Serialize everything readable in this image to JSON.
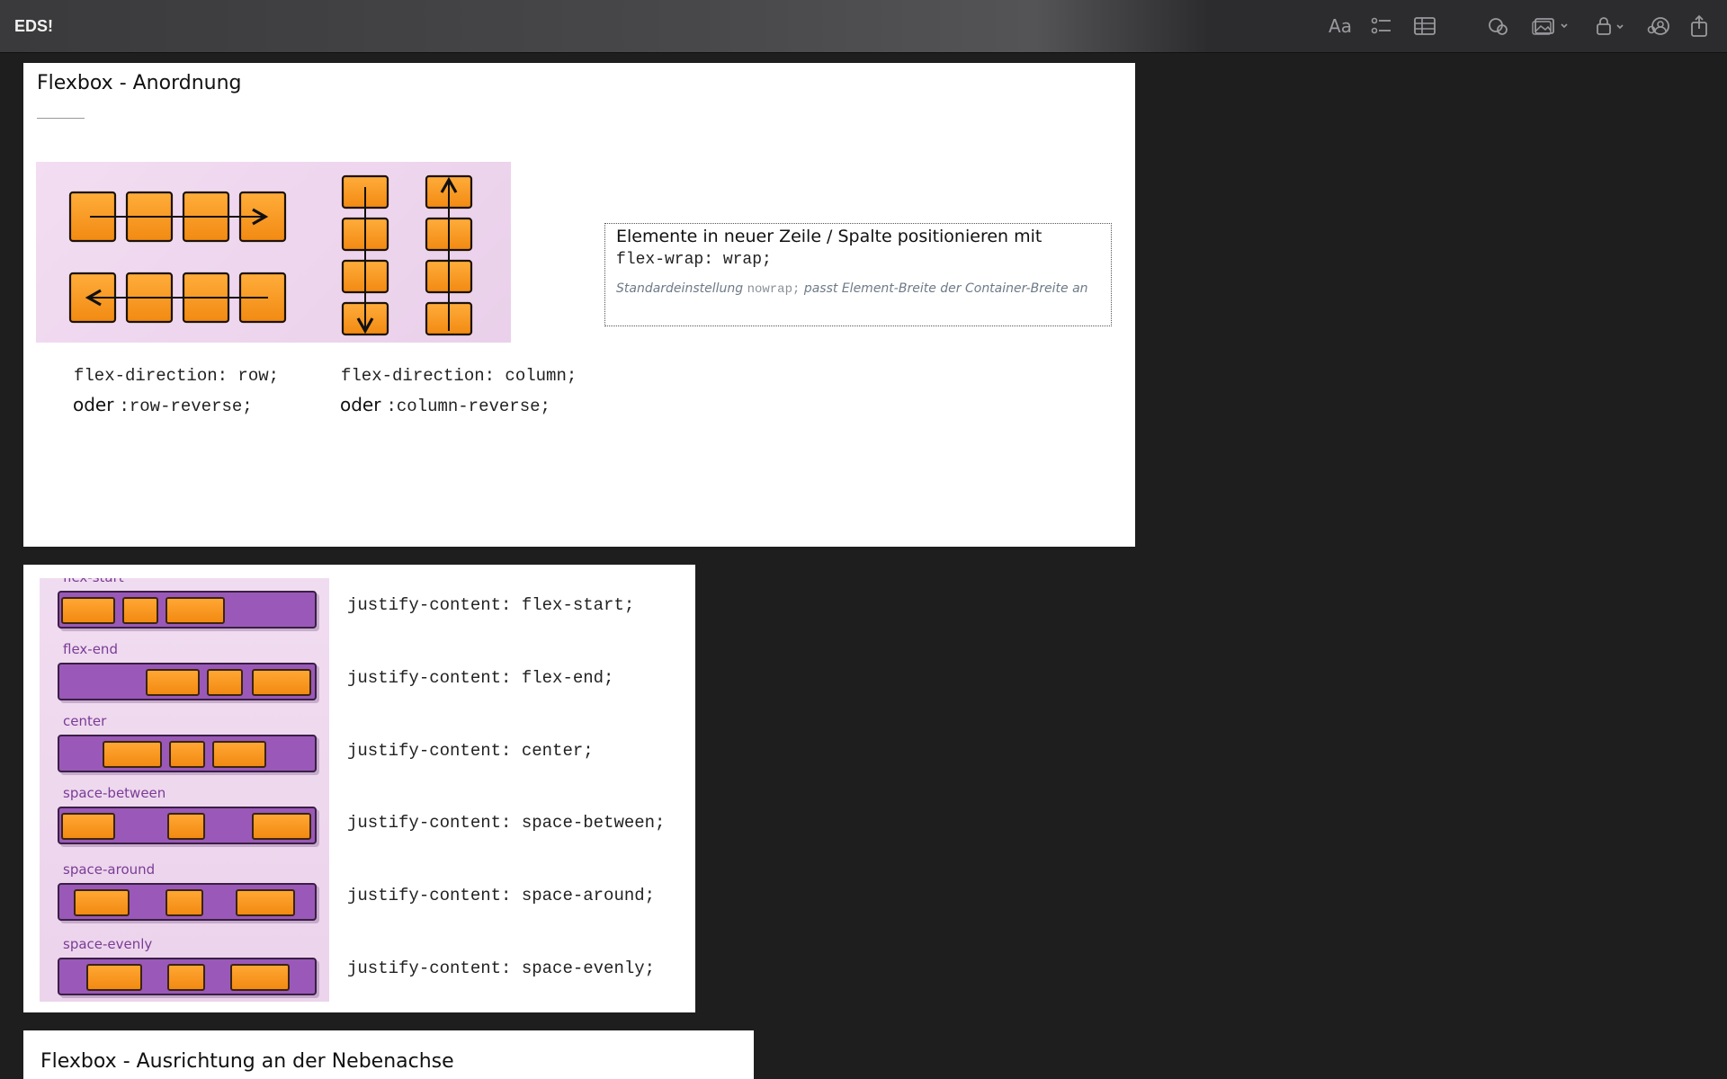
{
  "app": {
    "title": "EDS!"
  },
  "toolbar": {
    "icons": [
      "text-format-icon",
      "checklist-icon",
      "table-icon",
      "collaborate-icon",
      "media-icon",
      "lock-icon",
      "share-person-icon",
      "share-icon"
    ],
    "format_label": "Aa"
  },
  "section1": {
    "title": "Flexbox - Anordnung",
    "row_code": "flex-direction: row;",
    "row_alt_word": "oder",
    "row_alt_code": ":row-reverse;",
    "col_code": "flex-direction: column;",
    "col_alt_word": "oder",
    "col_alt_code": ":column-reverse;",
    "wrap_heading": "Elemente in neuer Zeile / Spalte positionieren mit",
    "wrap_code": "flex-wrap: wrap;",
    "wrap_note_pre": "Standardeinstellung",
    "wrap_note_code": "nowrap;",
    "wrap_note_post": "passt Element-Breite der Container-Breite an"
  },
  "section2": {
    "items": [
      {
        "label": "flex-start",
        "code": "justify-content: flex-start;"
      },
      {
        "label": "flex-end",
        "code": "justify-content: flex-end;"
      },
      {
        "label": "center",
        "code": "justify-content: center;"
      },
      {
        "label": "space-between",
        "code": "justify-content: space-between;"
      },
      {
        "label": "space-around",
        "code": "justify-content: space-around;"
      },
      {
        "label": "space-evenly",
        "code": "justify-content: space-evenly;"
      }
    ]
  },
  "section3": {
    "title": "Flexbox - Ausrichtung an der Nebenachse"
  },
  "colors": {
    "orange": "#f7941d",
    "purple": "#9a59b8",
    "background": "#1e1e1e"
  }
}
